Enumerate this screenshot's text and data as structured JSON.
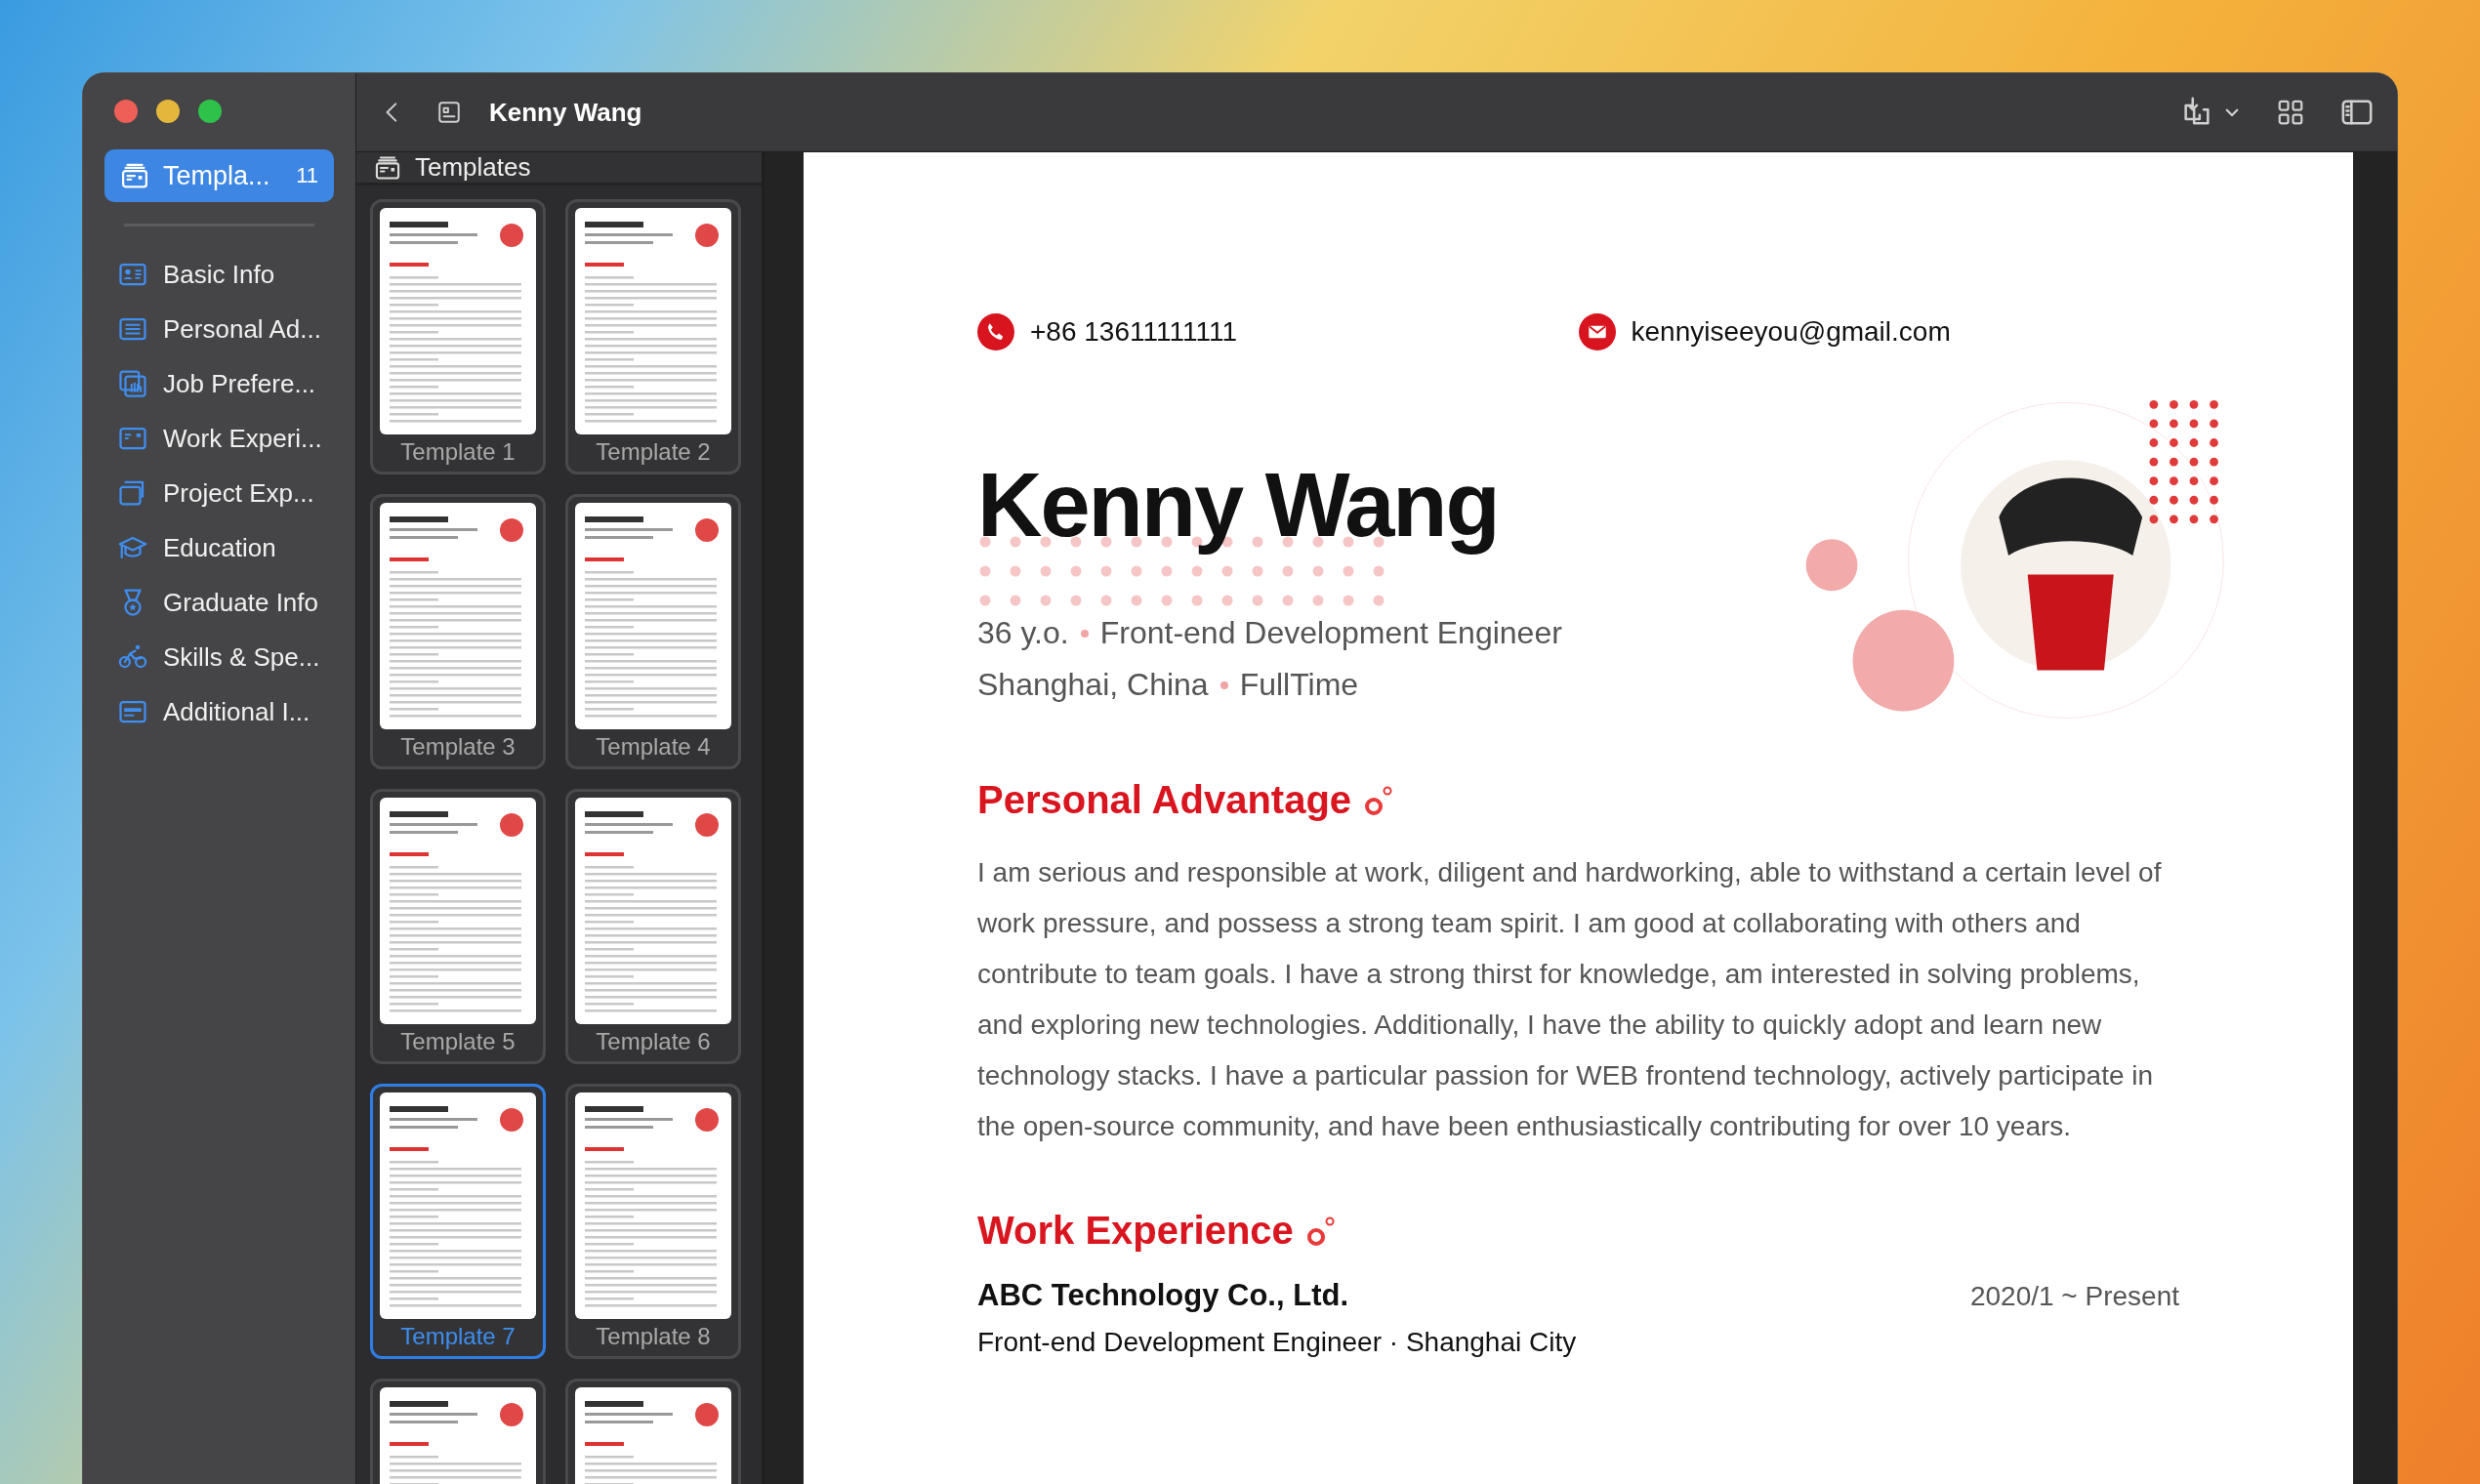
{
  "window": {
    "title": "Kenny Wang"
  },
  "sidebar": {
    "top": {
      "label": "Templa...",
      "count": "11",
      "selected": true
    },
    "items": [
      {
        "label": "Basic Info",
        "selected": false
      },
      {
        "label": "Personal Ad...",
        "selected": false
      },
      {
        "label": "Job Prefere...",
        "selected": false
      },
      {
        "label": "Work Experi...",
        "selected": false
      },
      {
        "label": "Project Exp...",
        "selected": false
      },
      {
        "label": "Education",
        "selected": false
      },
      {
        "label": "Graduate Info",
        "selected": false
      },
      {
        "label": "Skills & Spe...",
        "selected": false
      },
      {
        "label": "Additional I...",
        "selected": false
      }
    ]
  },
  "templates": {
    "title": "Templates",
    "items": [
      {
        "label": "Template 1",
        "selected": false
      },
      {
        "label": "Template 2",
        "selected": false
      },
      {
        "label": "Template 3",
        "selected": false
      },
      {
        "label": "Template 4",
        "selected": false
      },
      {
        "label": "Template 5",
        "selected": false
      },
      {
        "label": "Template 6",
        "selected": false
      },
      {
        "label": "Template 7",
        "selected": true
      },
      {
        "label": "Template 8",
        "selected": false
      },
      {
        "selected": false
      },
      {
        "selected": false
      }
    ]
  },
  "resume": {
    "contacts": [
      {
        "kind": "phone",
        "text": "+86 13611111111"
      },
      {
        "kind": "email",
        "text": "kennyiseeyou@gmail.com"
      }
    ],
    "name": "Kenny Wang",
    "details": [
      [
        "36 y.o.",
        "Front-end Development Engineer"
      ],
      [
        "Shanghai, China",
        "FullTime"
      ]
    ],
    "sections": [
      {
        "title": "Personal Advantage",
        "paragraph": "I am serious and responsible at work, diligent and hardworking, able to withstand a certain level of work pressure, and possess a strong team spirit. I am good at collaborating with others and contribute to team goals. I have a strong thirst for knowledge, am interested in solving problems, and exploring new technologies. Additionally, I have the ability to quickly adopt and learn new technology stacks. I have a particular passion for WEB frontend technology, actively participate in the open-source community, and have been enthusiastically contributing for over 10 years."
      },
      {
        "title": "Work Experience",
        "entries": [
          {
            "company": "ABC Technology Co., Ltd.",
            "date": "2020/1 ~ Present",
            "role": "Front-end Development Engineer · Shanghai City"
          }
        ]
      }
    ]
  }
}
